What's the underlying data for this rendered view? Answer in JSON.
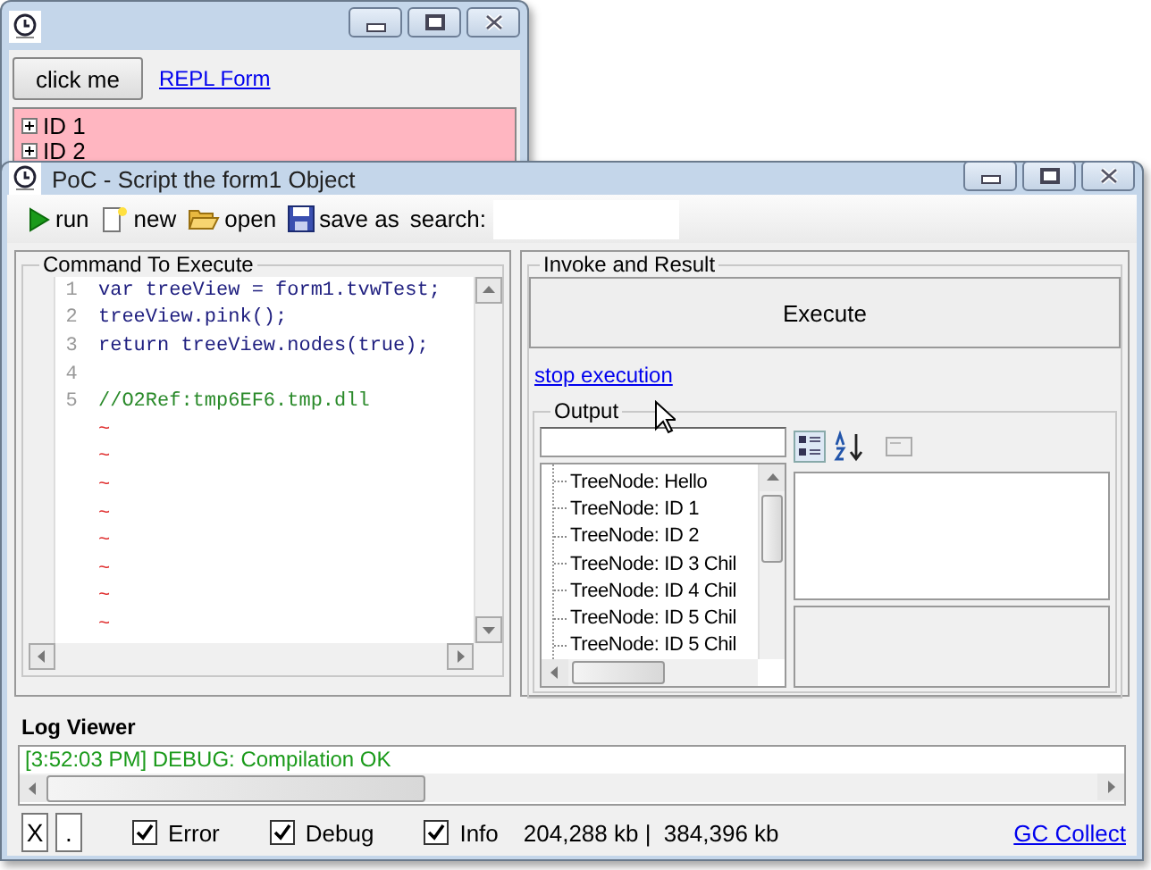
{
  "back_window": {
    "button": "click me",
    "link": "REPL Form",
    "tree": [
      {
        "label": "ID 1",
        "expanded": false
      },
      {
        "label": "ID 2",
        "expanded": false
      }
    ]
  },
  "main_window": {
    "title": "PoC - Script the form1 Object",
    "toolbar": [
      {
        "label": "run",
        "kind": "run"
      },
      {
        "label": "new",
        "kind": "new"
      },
      {
        "label": "open",
        "kind": "open"
      },
      {
        "label": "save as",
        "kind": "save"
      }
    ],
    "search_label": "search:",
    "command_panel": {
      "title": "Command To Execute",
      "lines": [
        {
          "number": "1",
          "text": "var treeView = form1.tvwTest;",
          "kind": "code"
        },
        {
          "number": "2",
          "text": "treeView.pink();",
          "kind": "code"
        },
        {
          "number": "3",
          "text": "return treeView.nodes(true);",
          "kind": "code"
        },
        {
          "number": "4"
        },
        {
          "number": "5",
          "text": "//O2Ref:tmp6EF6.tmp.dll",
          "kind": "comment"
        }
      ],
      "empty_markers": [
        "~",
        "~",
        "~",
        "~",
        "~",
        "~",
        "~",
        "~"
      ]
    },
    "result_panel": {
      "title": "Invoke and Result",
      "execute_button": "Execute",
      "stop_link": "stop execution",
      "output": {
        "title": "Output",
        "nodes": [
          "TreeNode: Hello",
          "TreeNode: ID 1",
          "TreeNode: ID 2",
          "TreeNode: ID 3 Chil",
          "TreeNode: ID 4 Chil",
          "TreeNode: ID 5 Chil",
          "TreeNode: ID 5 Chil"
        ]
      }
    },
    "log_viewer": {
      "title": "Log Viewer",
      "entries": [
        {
          "text": "[3:52:03 PM] DEBUG: Compilation OK",
          "kind": "debug"
        }
      ]
    },
    "status_bar": {
      "buttons": [
        "X",
        "."
      ],
      "filters": [
        {
          "label": "Error",
          "checked": true
        },
        {
          "label": "Debug",
          "checked": true
        },
        {
          "label": "Info",
          "checked": true
        }
      ],
      "memory": "204,288 kb |  384,396 kb",
      "link": "GC Collect"
    }
  }
}
